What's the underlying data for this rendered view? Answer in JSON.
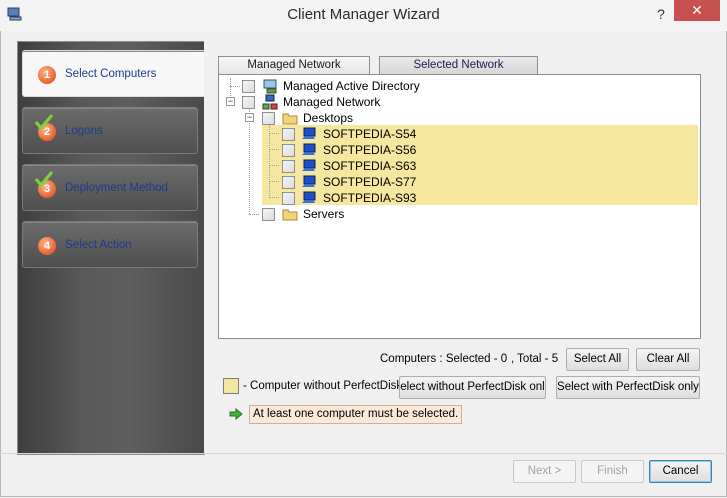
{
  "window": {
    "title": "Client Manager Wizard",
    "help_label": "?",
    "close_label": "✕"
  },
  "steps": [
    {
      "number": "1",
      "label": "Select Computers",
      "state": "active"
    },
    {
      "number": "2",
      "label": "Logons",
      "state": "done"
    },
    {
      "number": "3",
      "label": "Deployment Method",
      "state": "done"
    },
    {
      "number": "4",
      "label": "Select Action",
      "state": "pending"
    }
  ],
  "tabs": [
    {
      "label": "Managed Network",
      "active": true
    },
    {
      "label": "Selected Network",
      "active": false
    }
  ],
  "tree": {
    "nodes": [
      {
        "label": "Managed Active Directory",
        "icon": "active-directory-icon"
      },
      {
        "label": "Managed Network",
        "icon": "network-icon"
      },
      {
        "label": "Desktops",
        "icon": "folder-icon"
      },
      {
        "label": "SOFTPEDIA-S54",
        "icon": "computer-icon"
      },
      {
        "label": "SOFTPEDIA-S56",
        "icon": "computer-icon"
      },
      {
        "label": "SOFTPEDIA-S63",
        "icon": "computer-icon"
      },
      {
        "label": "SOFTPEDIA-S77",
        "icon": "computer-icon"
      },
      {
        "label": "SOFTPEDIA-S93",
        "icon": "computer-icon"
      },
      {
        "label": "Servers",
        "icon": "folder-icon"
      }
    ]
  },
  "counts": {
    "selected_text": "Computers : Selected - 0",
    "total_text": ", Total - 5"
  },
  "buttons": {
    "select_all": "Select All",
    "clear_all": "Clear All",
    "select_without": "elect without PerfectDisk onl",
    "select_with": "Select with PerfectDisk only",
    "next": "Next >",
    "finish": "Finish",
    "cancel": "Cancel"
  },
  "legend": {
    "text": "- Computer without PerfectDisk"
  },
  "warning": {
    "text": "At least one computer must be selected."
  },
  "colors": {
    "highlight": "#f5e79e",
    "warning_bg": "#fbe8d8",
    "step_number": "#e8612e",
    "close_button": "#c75050"
  }
}
